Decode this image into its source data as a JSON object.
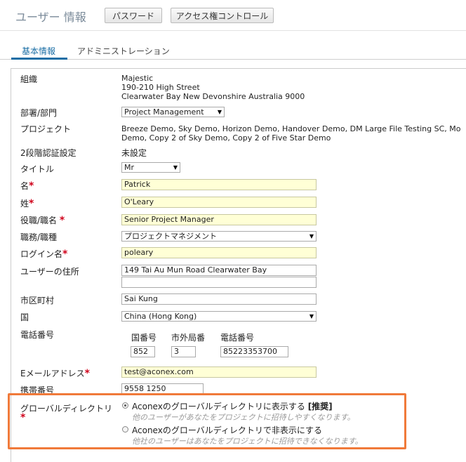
{
  "header": {
    "title": "ユーザー 情報",
    "password_button": "パスワード",
    "access_button": "アクセス権コントロール"
  },
  "tabs": [
    {
      "label": "基本情報",
      "active": true
    },
    {
      "label": "アドミニストレーション",
      "active": false
    }
  ],
  "form": {
    "org_label": "組織",
    "org_lines": [
      "Majestic",
      "190-210 High Street",
      "Clearwater Bay New Devonshire Australia 9000"
    ],
    "dept_label": "部署/部門",
    "dept_value": "Project Management",
    "project_label": "プロジェクト",
    "project_lines": [
      "Breeze Demo, Sky Demo, Horizon Demo, Handover Demo, DM Large File Testing SC, Mo",
      "Demo, Copy 2 of Sky Demo, Copy 2 of Five Star Demo"
    ],
    "twofa_label": "2段階認証設定",
    "twofa_value": "未設定",
    "honorific_label": "タイトル",
    "honorific_value": "Mr",
    "first_name_label": "名",
    "first_name_value": "Patrick",
    "last_name_label": "姓",
    "last_name_value": "O'Leary",
    "job_title_label": "役職/職名",
    "job_title_value": "Senior Project Manager",
    "job_type_label": "職務/職種",
    "job_type_value": "プロジェクトマネジメント",
    "login_label": "ログイン名",
    "login_value": "poleary",
    "address_label": "ユーザーの住所",
    "address_line1": "149 Tai Au Mun Road Clearwater Bay",
    "address_line2": "",
    "city_label": "市区町村",
    "city_value": "Sai Kung",
    "country_label": "国",
    "country_value": "China (Hong Kong)",
    "phone_label": "電話番号",
    "phone_country_code_label": "国番号",
    "phone_area_code_label": "市外局番",
    "phone_number_label": "電話番号",
    "phone_country_code": "852",
    "phone_area_code": "3",
    "phone_number": "85223353700",
    "email_label": "Eメールアドレス",
    "email_value": "test@aconex.com",
    "mobile_label": "携帯番号",
    "mobile_value": "9558 1250",
    "directory_label": "グローバルディレクトリ",
    "required_mark": "*",
    "directory_options": [
      {
        "label": "Aconexのグローバルディレクトリに表示する",
        "badge": "[推奨]",
        "hint": "他のユーザーがあなたをプロジェクトに招待しやすくなります。",
        "selected": true
      },
      {
        "label": "Aconexのグローバルディレクトリで非表示にする",
        "badge": "",
        "hint": "他社のユーザーはあなたをプロジェクトに招待できなくなります。",
        "selected": false
      }
    ]
  },
  "colors": {
    "accent": "#1a6ea5",
    "required": "#d0021b",
    "highlight_border": "#f07a3a",
    "input_highlight": "#ffffd6"
  }
}
